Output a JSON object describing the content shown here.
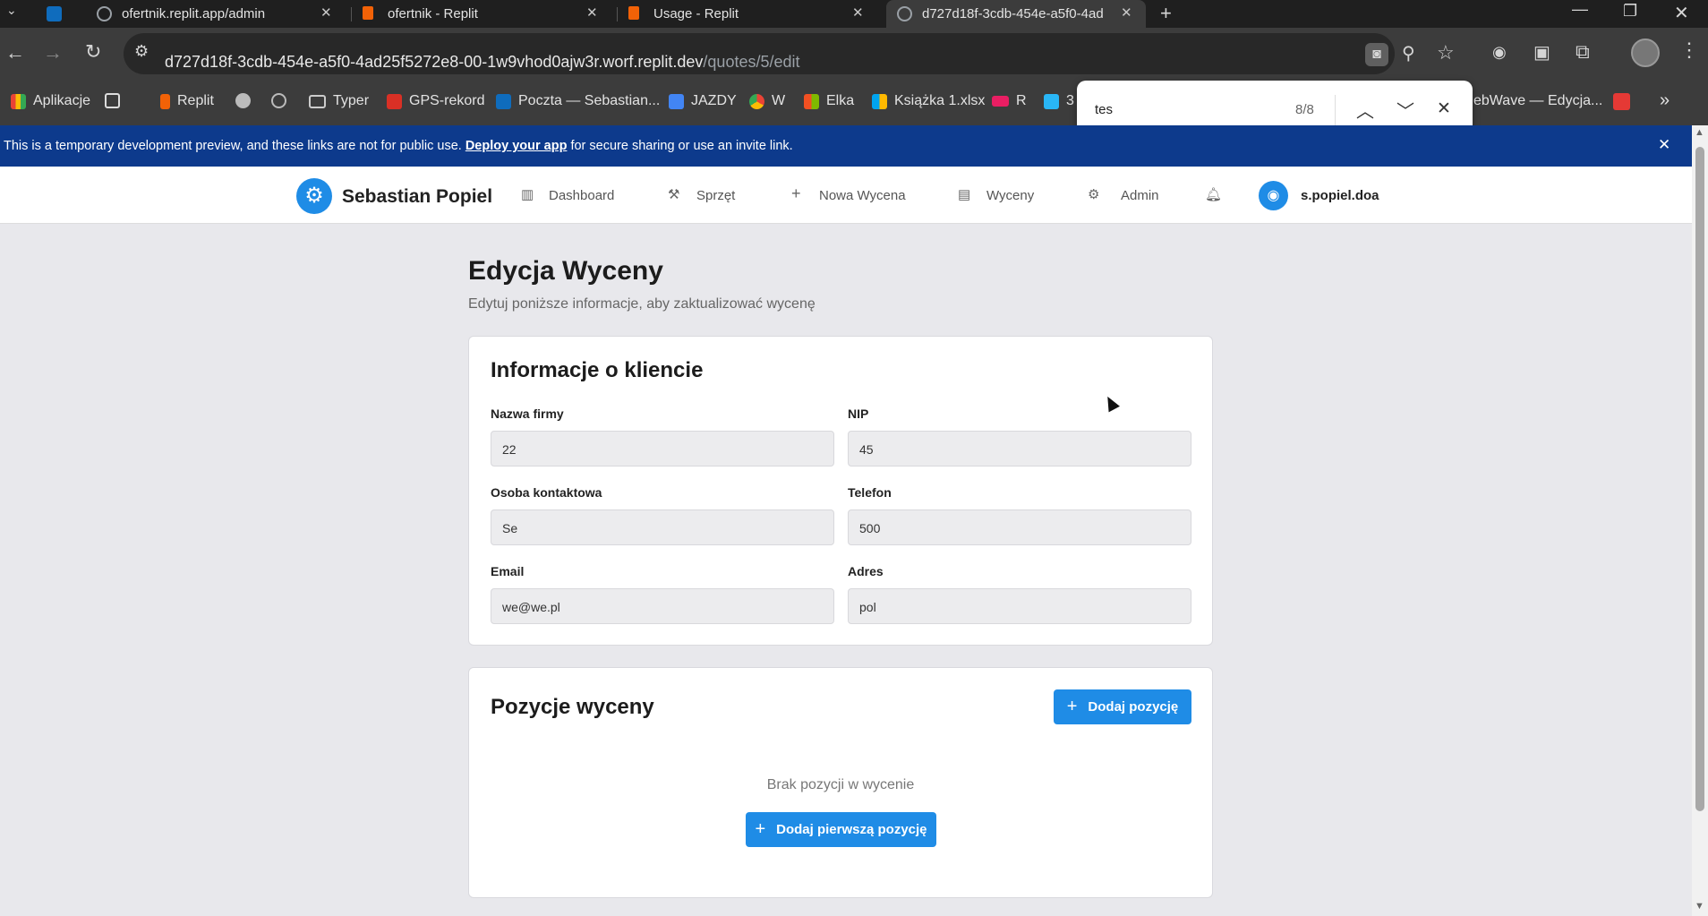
{
  "browser": {
    "tabs": [
      {
        "title": "",
        "icon": "outlook-icon",
        "color": "#0f6cbd"
      },
      {
        "title": "ofertnik.replit.app/admin",
        "icon": "globe-icon",
        "color": "#9aa0a6"
      },
      {
        "title": "ofertnik - Replit",
        "icon": "replit-icon",
        "color": "#f26207"
      },
      {
        "title": "Usage - Replit",
        "icon": "replit-icon",
        "color": "#f26207"
      },
      {
        "title": "d727d18f-3cdb-454e-a5f0-4ad",
        "icon": "globe-icon",
        "color": "#9aa0a6"
      }
    ],
    "url_main": "d727d18f-3cdb-454e-a5f0-4ad25f5272e8-00-1w9vhod0ajw3r.worf.replit.dev",
    "url_path": "/quotes/5/edit",
    "bookmarks": [
      "Aplikacje",
      "Replit",
      "Typer",
      "GPS-rekord",
      "Poczta — Sebastian...",
      "JAZDY",
      "W",
      "Elka",
      "Książka 1.xlsx",
      "R",
      "3"
    ],
    "bookmark_right": "ebWave — Edycja...",
    "find": {
      "query": "tes",
      "count": "8/8"
    }
  },
  "banner": {
    "text_before": "This is a temporary development preview, and these links are not for public use. ",
    "link": "Deploy your app",
    "text_after": " for secure sharing or use an invite link."
  },
  "nav": {
    "brand": "Sebastian Popiel",
    "items": [
      "Dashboard",
      "Sprzęt",
      "Nowa Wycena",
      "Wyceny",
      "Admin"
    ],
    "user": "s.popiel.doa"
  },
  "main": {
    "title": "Edycja Wyceny",
    "subtitle": "Edytuj poniższe informacje, aby zaktualizować wycenę"
  },
  "client": {
    "section_title": "Informacje o kliencie",
    "company_label": "Nazwa firmy",
    "company_value": "22",
    "nip_label": "NIP",
    "nip_value": "45",
    "contact_label": "Osoba kontaktowa",
    "contact_value": "Se",
    "phone_label": "Telefon",
    "phone_value": "500",
    "email_label": "Email",
    "email_value": "we@we.pl",
    "address_label": "Adres",
    "address_value": "pol"
  },
  "items": {
    "section_title": "Pozycje wyceny",
    "add_button": "Dodaj pozycję",
    "empty_text": "Brak pozycji w wycenie",
    "add_first_button": "Dodaj pierwszą pozycję"
  },
  "colors": {
    "accent": "#1f8ce6",
    "banner": "#0d3a8c"
  }
}
